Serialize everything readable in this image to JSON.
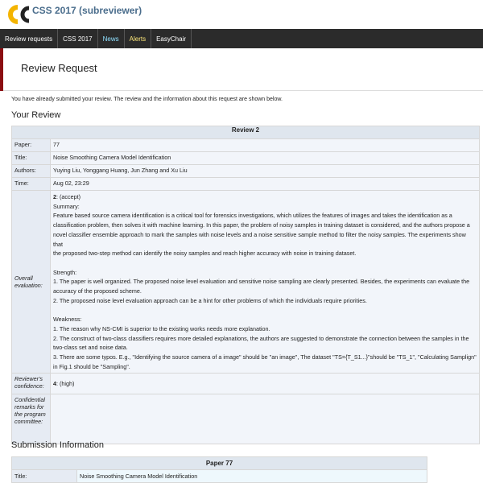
{
  "app": {
    "title": "CSS 2017 (subreviewer)"
  },
  "menu": {
    "items": [
      {
        "label": "Review requests"
      },
      {
        "label": "CSS 2017"
      },
      {
        "label": "News"
      },
      {
        "label": "Alerts"
      },
      {
        "label": "EasyChair"
      }
    ]
  },
  "page": {
    "title": "Review Request",
    "info": "You have already submitted your review. The review and the information about this request are shown below."
  },
  "review": {
    "heading": "Your Review",
    "caption": "Review 2",
    "paper_label": "Paper:",
    "paper_value": "77",
    "title_label": "Title:",
    "title_value": "Noise Smoothing Camera Model Identification",
    "authors_label": "Authors:",
    "authors_value": "Yuying Liu, Yonggang Huang, Jun Zhang and Xu Liu",
    "time_label": "Time:",
    "time_value": "Aug 02, 23:29",
    "eval_label": "Overall evaluation:",
    "eval_score": "2",
    "eval_score_text": ": (accept)",
    "eval_lines": [
      "Summary:",
      "Feature based source camera identification is a critical tool for forensics investigations, which utilizes the features of images and takes the identification as a",
      "classification problem, then solves it with machine learning. In this paper, the problem of noisy samples in training dataset is considered, and the authors propose a",
      "novel classifier ensemble approach to mark the samples with noise levels and a noise sensitive sample method to filter the noisy samples. The experiments show that",
      "the proposed two-step method can identify the noisy samples and reach higher accuracy with noise in training dataset.",
      "",
      "Strength:",
      "1. The paper is well organized. The proposed noise level evaluation and sensitive noise sampling are clearly presented. Besides, the experiments can evaluate the",
      "accuracy of the proposed scheme.",
      "2. The proposed noise level evaluation approach can be a hint for other problems of which the individuals require priorities.",
      "",
      "Weakness:",
      "1. The reason why NS-CMI is superior to the existing works needs more explanation.",
      "2. The construct of two-class classifiers requires more detailed explanations, the authors are suggested to demonstrate the connection between the samples in the",
      "two-class set and noise data.",
      "3. There are some typos. E.g., \"Identifying the source camera of a image\" should be \"an image\", The dataset \"TS={T_S1...}\"should be \"TS_1\", \"Calculating Samplign\"",
      "in Fig.1 should be \"Sampling\"."
    ],
    "confidence_label": "Reviewer's confidence:",
    "confidence_score": "4",
    "confidence_text": ": (high)",
    "confidential_label": "Confidential remarks for the program committee:",
    "confidential_value": ""
  },
  "submission": {
    "heading": "Submission Information",
    "caption": "Paper 77",
    "title_label": "Title:",
    "title_value": "Noise Smoothing Camera Model Identification"
  },
  "colors": {
    "menubar": "#2b2b2b",
    "accent": "#8b0d12",
    "title_blue": "#4a6d8c",
    "logo_yellow": "#f4b400"
  }
}
